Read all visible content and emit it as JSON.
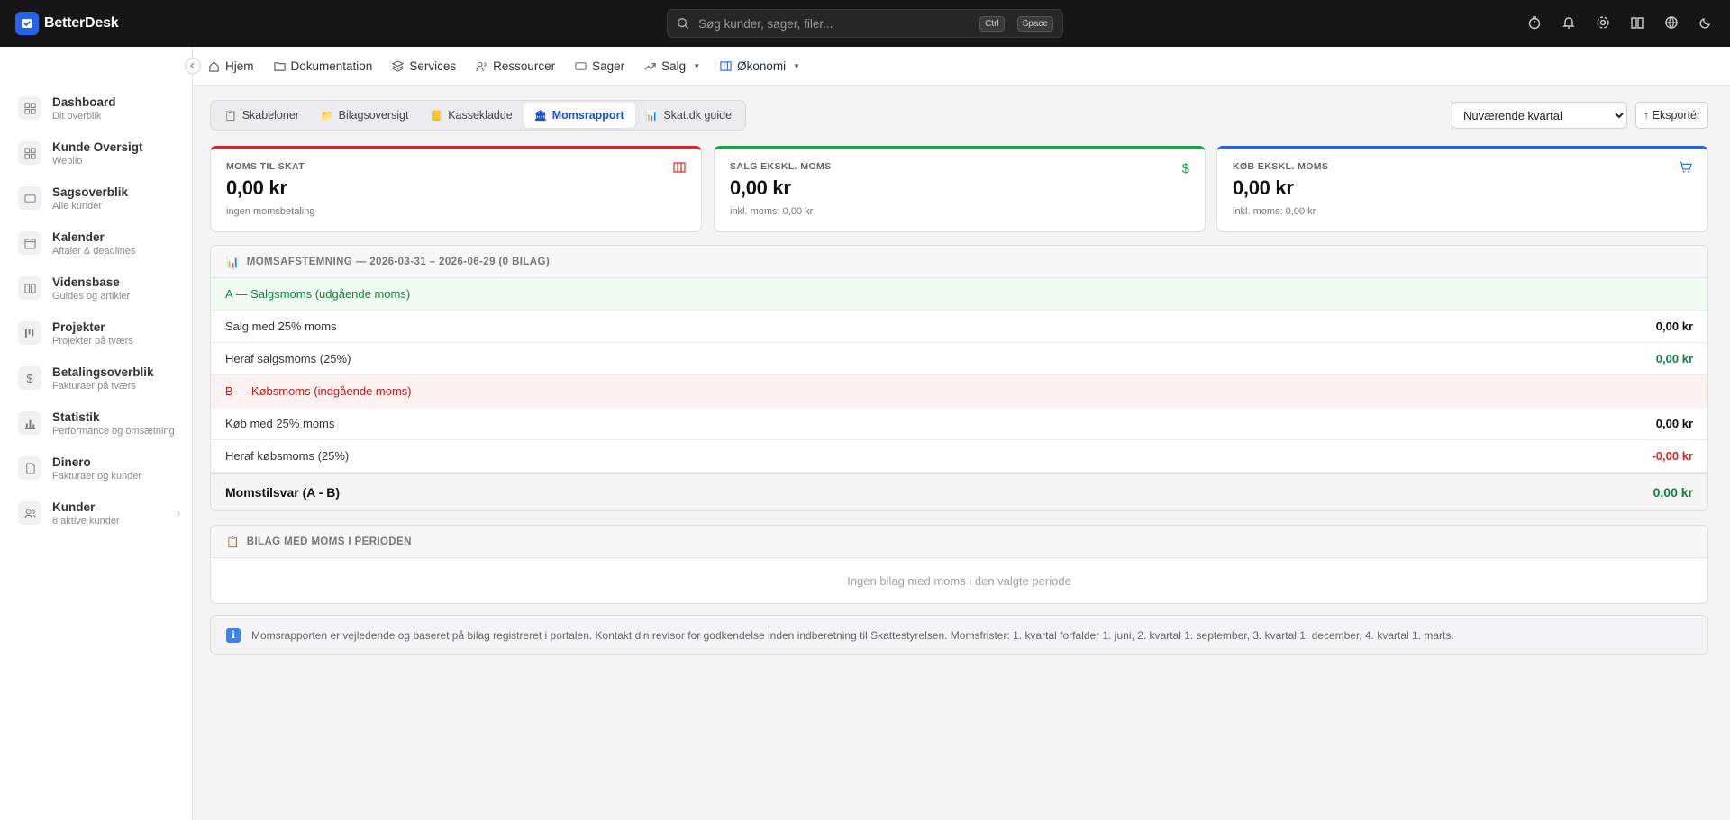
{
  "app": {
    "name": "BetterDesk",
    "brand_color": "#2563eb"
  },
  "search": {
    "placeholder": "Søg kunder, sager, filer...",
    "kbd1": "Ctrl",
    "kbd2": "Space"
  },
  "top_icons": [
    "timer-icon",
    "bell-icon",
    "gear-icon",
    "book-icon",
    "globe-icon",
    "moon-icon"
  ],
  "sidebar": {
    "items": [
      {
        "title": "Dashboard",
        "sub": "Dit overblik",
        "icon": "grid-icon"
      },
      {
        "title": "Kunde Oversigt",
        "sub": "Weblio",
        "icon": "grid-icon"
      },
      {
        "title": "Sagsoverblik",
        "sub": "Alle kunder",
        "icon": "ticket-icon"
      },
      {
        "title": "Kalender",
        "sub": "Aftaler & deadlines",
        "icon": "calendar-icon"
      },
      {
        "title": "Vidensbase",
        "sub": "Guides og artikler",
        "icon": "book-icon"
      },
      {
        "title": "Projekter",
        "sub": "Projekter på tværs",
        "icon": "kanban-icon"
      },
      {
        "title": "Betalingsoverblik",
        "sub": "Fakturaer på tværs",
        "icon": "dollar-icon"
      },
      {
        "title": "Statistik",
        "sub": "Performance og omsætning",
        "icon": "bar-chart-icon"
      },
      {
        "title": "Dinero",
        "sub": "Fakturaer og kunder",
        "icon": "file-dollar-icon"
      },
      {
        "title": "Kunder",
        "sub": "8 aktive kunder",
        "icon": "users-icon"
      }
    ]
  },
  "topnav": {
    "items": [
      {
        "label": "Hjem",
        "icon": "home-icon"
      },
      {
        "label": "Dokumentation",
        "icon": "folder-icon"
      },
      {
        "label": "Services",
        "icon": "layers-icon"
      },
      {
        "label": "Ressourcer",
        "icon": "users-icon"
      },
      {
        "label": "Sager",
        "icon": "ticket-icon"
      },
      {
        "label": "Salg",
        "icon": "trend-icon"
      },
      {
        "label": "Økonomi",
        "icon": "columns-icon"
      }
    ]
  },
  "tabs": [
    {
      "label": "Skabeloner",
      "icon": "📋"
    },
    {
      "label": "Bilagsoversigt",
      "icon": "📁"
    },
    {
      "label": "Kassekladde",
      "icon": "📒"
    },
    {
      "label": "Momsrapport",
      "icon": "🏛"
    },
    {
      "label": "Skat.dk guide",
      "icon": "📊"
    }
  ],
  "period": {
    "selected": "Nuværende kvartal"
  },
  "export_label": "↑ Eksportér",
  "stats": [
    {
      "label": "MOMS TIL SKAT",
      "value": "0,00 kr",
      "sub": "ingen momsbetaling",
      "accent": "#dc2626",
      "icon": "columns-icon"
    },
    {
      "label": "SALG EKSKL. MOMS",
      "value": "0,00 kr",
      "sub": "inkl. moms: 0,00 kr",
      "accent": "#16a34a",
      "icon": "dollar-icon"
    },
    {
      "label": "KØB EKSKL. MOMS",
      "value": "0,00 kr",
      "sub": "inkl. moms: 0,00 kr",
      "accent": "#2563eb",
      "icon": "cart-icon"
    }
  ],
  "reconciliation": {
    "title": "MOMSAFSTEMNING — 2026-03-31 – 2026-06-29 (0 BILAG)",
    "section_a": "A — Salgsmoms (udgående moms)",
    "row1_label": "Salg med 25% moms",
    "row1_value": "0,00 kr",
    "row2_label": "Heraf salgsmoms (25%)",
    "row2_value": "0,00 kr",
    "section_b": "B — Købsmoms (indgående moms)",
    "row3_label": "Køb med 25% moms",
    "row3_value": "0,00 kr",
    "row4_label": "Heraf købsmoms (25%)",
    "row4_value": "-0,00 kr",
    "total_label": "Momstilsvar (A - B)",
    "total_value": "0,00 kr"
  },
  "vouchers": {
    "title": "BILAG MED MOMS I PERIODEN",
    "empty": "Ingen bilag med moms i den valgte periode"
  },
  "info": {
    "text": "Momsrapporten er vejledende og baseret på bilag registreret i portalen. Kontakt din revisor for godkendelse inden indberetning til Skattestyrelsen. Momsfrister: 1. kvartal forfalder 1. juni, 2. kvartal 1. september, 3. kvartal 1. december, 4. kvartal 1. marts."
  }
}
